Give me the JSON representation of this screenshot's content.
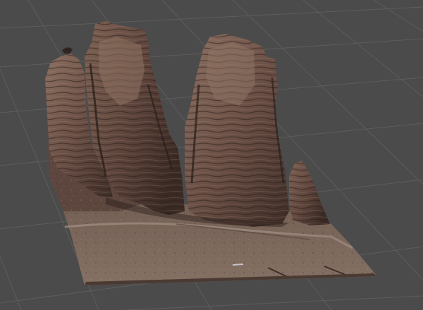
{
  "viewport": {
    "background": "#4b4b4b",
    "grid_visible": true,
    "grid_color": "#5e5e5e",
    "object": "photogrammetry-rock-formation-model",
    "object_colors": {
      "rock_light": "#8a6d5e",
      "rock_mid": "#6b5046",
      "rock_dark": "#3a2a25",
      "ground": "#7a6658",
      "ground_dark": "#4e3e36",
      "track": "#9a8a80"
    }
  }
}
